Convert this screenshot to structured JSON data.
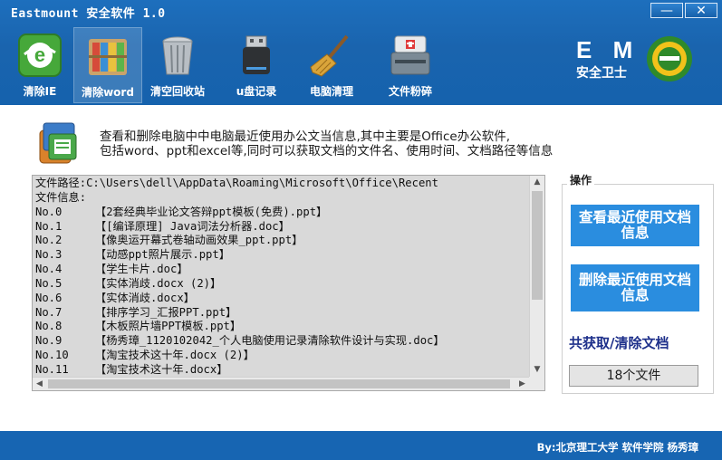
{
  "window": {
    "title": "Eastmount 安全软件 1.0",
    "minimize_label": "—",
    "close_label": "✕"
  },
  "toolbar": {
    "items": [
      {
        "label": "清除IE",
        "icon": "ie-icon"
      },
      {
        "label": "清除word",
        "icon": "books-icon",
        "active": true
      },
      {
        "label": "清空回收站",
        "icon": "recycle-bin-icon"
      },
      {
        "label": "u盘记录",
        "icon": "usb-drive-icon"
      },
      {
        "label": "电脑清理",
        "icon": "broom-icon"
      },
      {
        "label": "文件粉碎",
        "icon": "shredder-icon"
      }
    ]
  },
  "logo": {
    "letters": "E M",
    "caption": "安全卫士",
    "icon": "e-logo-icon"
  },
  "description": {
    "line1": "查看和删除电脑中中电脑最近使用办公文当信息,其中主要是Office办公软件,",
    "line2": "包括word、ppt和excel等,同时可以获取文档的文件名、使用时间、文档路径等信息",
    "icon": "office-apps-icon"
  },
  "text_area": {
    "lines": [
      "文件路径:C:\\Users\\dell\\AppData\\Roaming\\Microsoft\\Office\\Recent",
      "文件信息:",
      "No.0     【2套经典毕业论文答辩ppt模板(免费).ppt】",
      "No.1     【[编译原理] Java词法分析器.doc】",
      "No.2     【像奥运开幕式卷轴动画效果_ppt.ppt】",
      "No.3     【动感ppt照片展示.ppt】",
      "No.4     【学生卡片.doc】",
      "No.5     【实体消歧.docx (2)】",
      "No.6     【实体消歧.docx】",
      "No.7     【排序学习_汇报PPT.ppt】",
      "No.8     【木板照片墙PPT模板.ppt】",
      "No.9     【杨秀璋_1120102042_个人电脑使用记录清除软件设计与实现.doc】",
      "No.10    【淘宝技术这十年.docx (2)】",
      "No.11    【淘宝技术这十年.docx】"
    ]
  },
  "operations": {
    "group_title": "操作",
    "view_button": "查看最近使用文档信息",
    "delete_button": "删除最近使用文档信息",
    "count_label": "共获取/清除文档",
    "count_value": "18个文件"
  },
  "footer": {
    "text": "By:北京理工大学 软件学院 杨秀璋"
  },
  "colors": {
    "header_bg": "#1a64ae",
    "button_bg": "#2a8ddf",
    "footer_bg": "#1765b2",
    "count_label": "#1d2f8a"
  }
}
